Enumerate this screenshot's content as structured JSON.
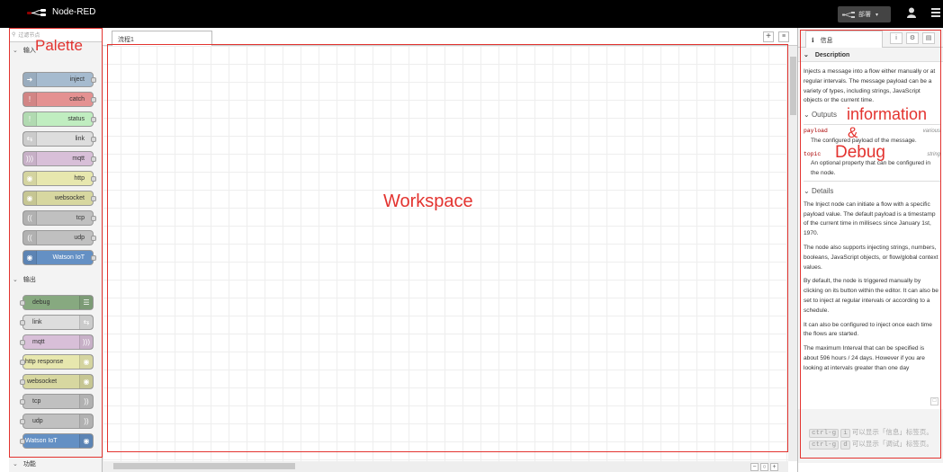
{
  "header": {
    "app_title": "Node-RED",
    "deploy_label": "部署",
    "deploy_caret": "▾"
  },
  "palette": {
    "search_placeholder": "过滤节点",
    "sections": [
      {
        "label": "输入",
        "nodes": [
          {
            "label": "inject",
            "color": "#a6bbcf",
            "icon": "arrow-right-icon"
          },
          {
            "label": "catch",
            "color": "#e49191",
            "icon": "alert-icon"
          },
          {
            "label": "status",
            "color": "#c0edc0",
            "icon": "info-icon"
          },
          {
            "label": "link",
            "color": "#dddddd",
            "icon": "link-icon"
          },
          {
            "label": "mqtt",
            "color": "#d8bfd8",
            "icon": "wave-icon"
          },
          {
            "label": "http",
            "color": "#e7e7ae",
            "icon": "globe-icon"
          },
          {
            "label": "websocket",
            "color": "#d7d7a0",
            "icon": "globe-icon"
          },
          {
            "label": "tcp",
            "color": "#c0c0c0",
            "icon": "bridge-icon"
          },
          {
            "label": "udp",
            "color": "#c0c0c0",
            "icon": "bridge-icon"
          },
          {
            "label": "Watson IoT",
            "color": "#6490c4",
            "icon": "watson-icon"
          }
        ]
      },
      {
        "label": "输出",
        "nodes": [
          {
            "label": "debug",
            "color": "#87a980",
            "icon": "debug-icon"
          },
          {
            "label": "link",
            "color": "#dddddd",
            "icon": "link-icon"
          },
          {
            "label": "mqtt",
            "color": "#d8bfd8",
            "icon": "wave-icon"
          },
          {
            "label": "http response",
            "color": "#e7e7ae",
            "icon": "globe-icon"
          },
          {
            "label": "websocket",
            "color": "#d7d7a0",
            "icon": "globe-icon"
          },
          {
            "label": "tcp",
            "color": "#c0c0c0",
            "icon": "bridge-icon"
          },
          {
            "label": "udp",
            "color": "#c0c0c0",
            "icon": "bridge-icon"
          },
          {
            "label": "Watson IoT",
            "color": "#6490c4",
            "icon": "watson-icon"
          }
        ]
      },
      {
        "label": "功能"
      }
    ]
  },
  "workspace": {
    "tab_label": "流程1",
    "add_tab": "+",
    "list_tabs": "≡",
    "zoom_out": "−",
    "zoom_reset": "○",
    "zoom_in": "+"
  },
  "sidebar": {
    "tab_label": "信息",
    "tab_icon": "ℹ",
    "description_header": "Description",
    "description": "Injects a message into a flow either manually or at regular intervals. The message payload can be a variety of types, including strings, JavaScript objects or the current time.",
    "outputs_header": "Outputs",
    "props": [
      {
        "name": "payload",
        "type": "various",
        "desc": "The configured payload of the message."
      },
      {
        "name": "topic",
        "type": "string",
        "desc": "An optional property that can be configured in the node."
      }
    ],
    "details_header": "Details",
    "details": [
      "The Inject node can initiate a flow with a specific payload value. The default payload is a timestamp of the current time in millisecs since January 1st, 1970.",
      "The node also supports injecting strings, numbers, booleans, JavaScript objects, or flow/global context values.",
      "By default, the node is triggered manually by clicking on its button within the editor. It can also be set to inject at regular intervals or according to a schedule.",
      "It can also be configured to inject once each time the flows are started.",
      "The maximum Interval that can be specified is about 596 hours / 24 days. However if you are looking at intervals greater than one day"
    ],
    "shortcut1_key": "ctrl-g",
    "shortcut1_key2": "i",
    "shortcut1_text": "可以显示「信息」标签页。",
    "shortcut2_key": "ctrl-g",
    "shortcut2_key2": "d",
    "shortcut2_text": "可以显示「调试」标签页。"
  },
  "annotations": {
    "palette": "Palette",
    "workspace": "Workspace",
    "info1": "information",
    "info2": "&",
    "info3": "Debug",
    "color": "#e3332f"
  }
}
